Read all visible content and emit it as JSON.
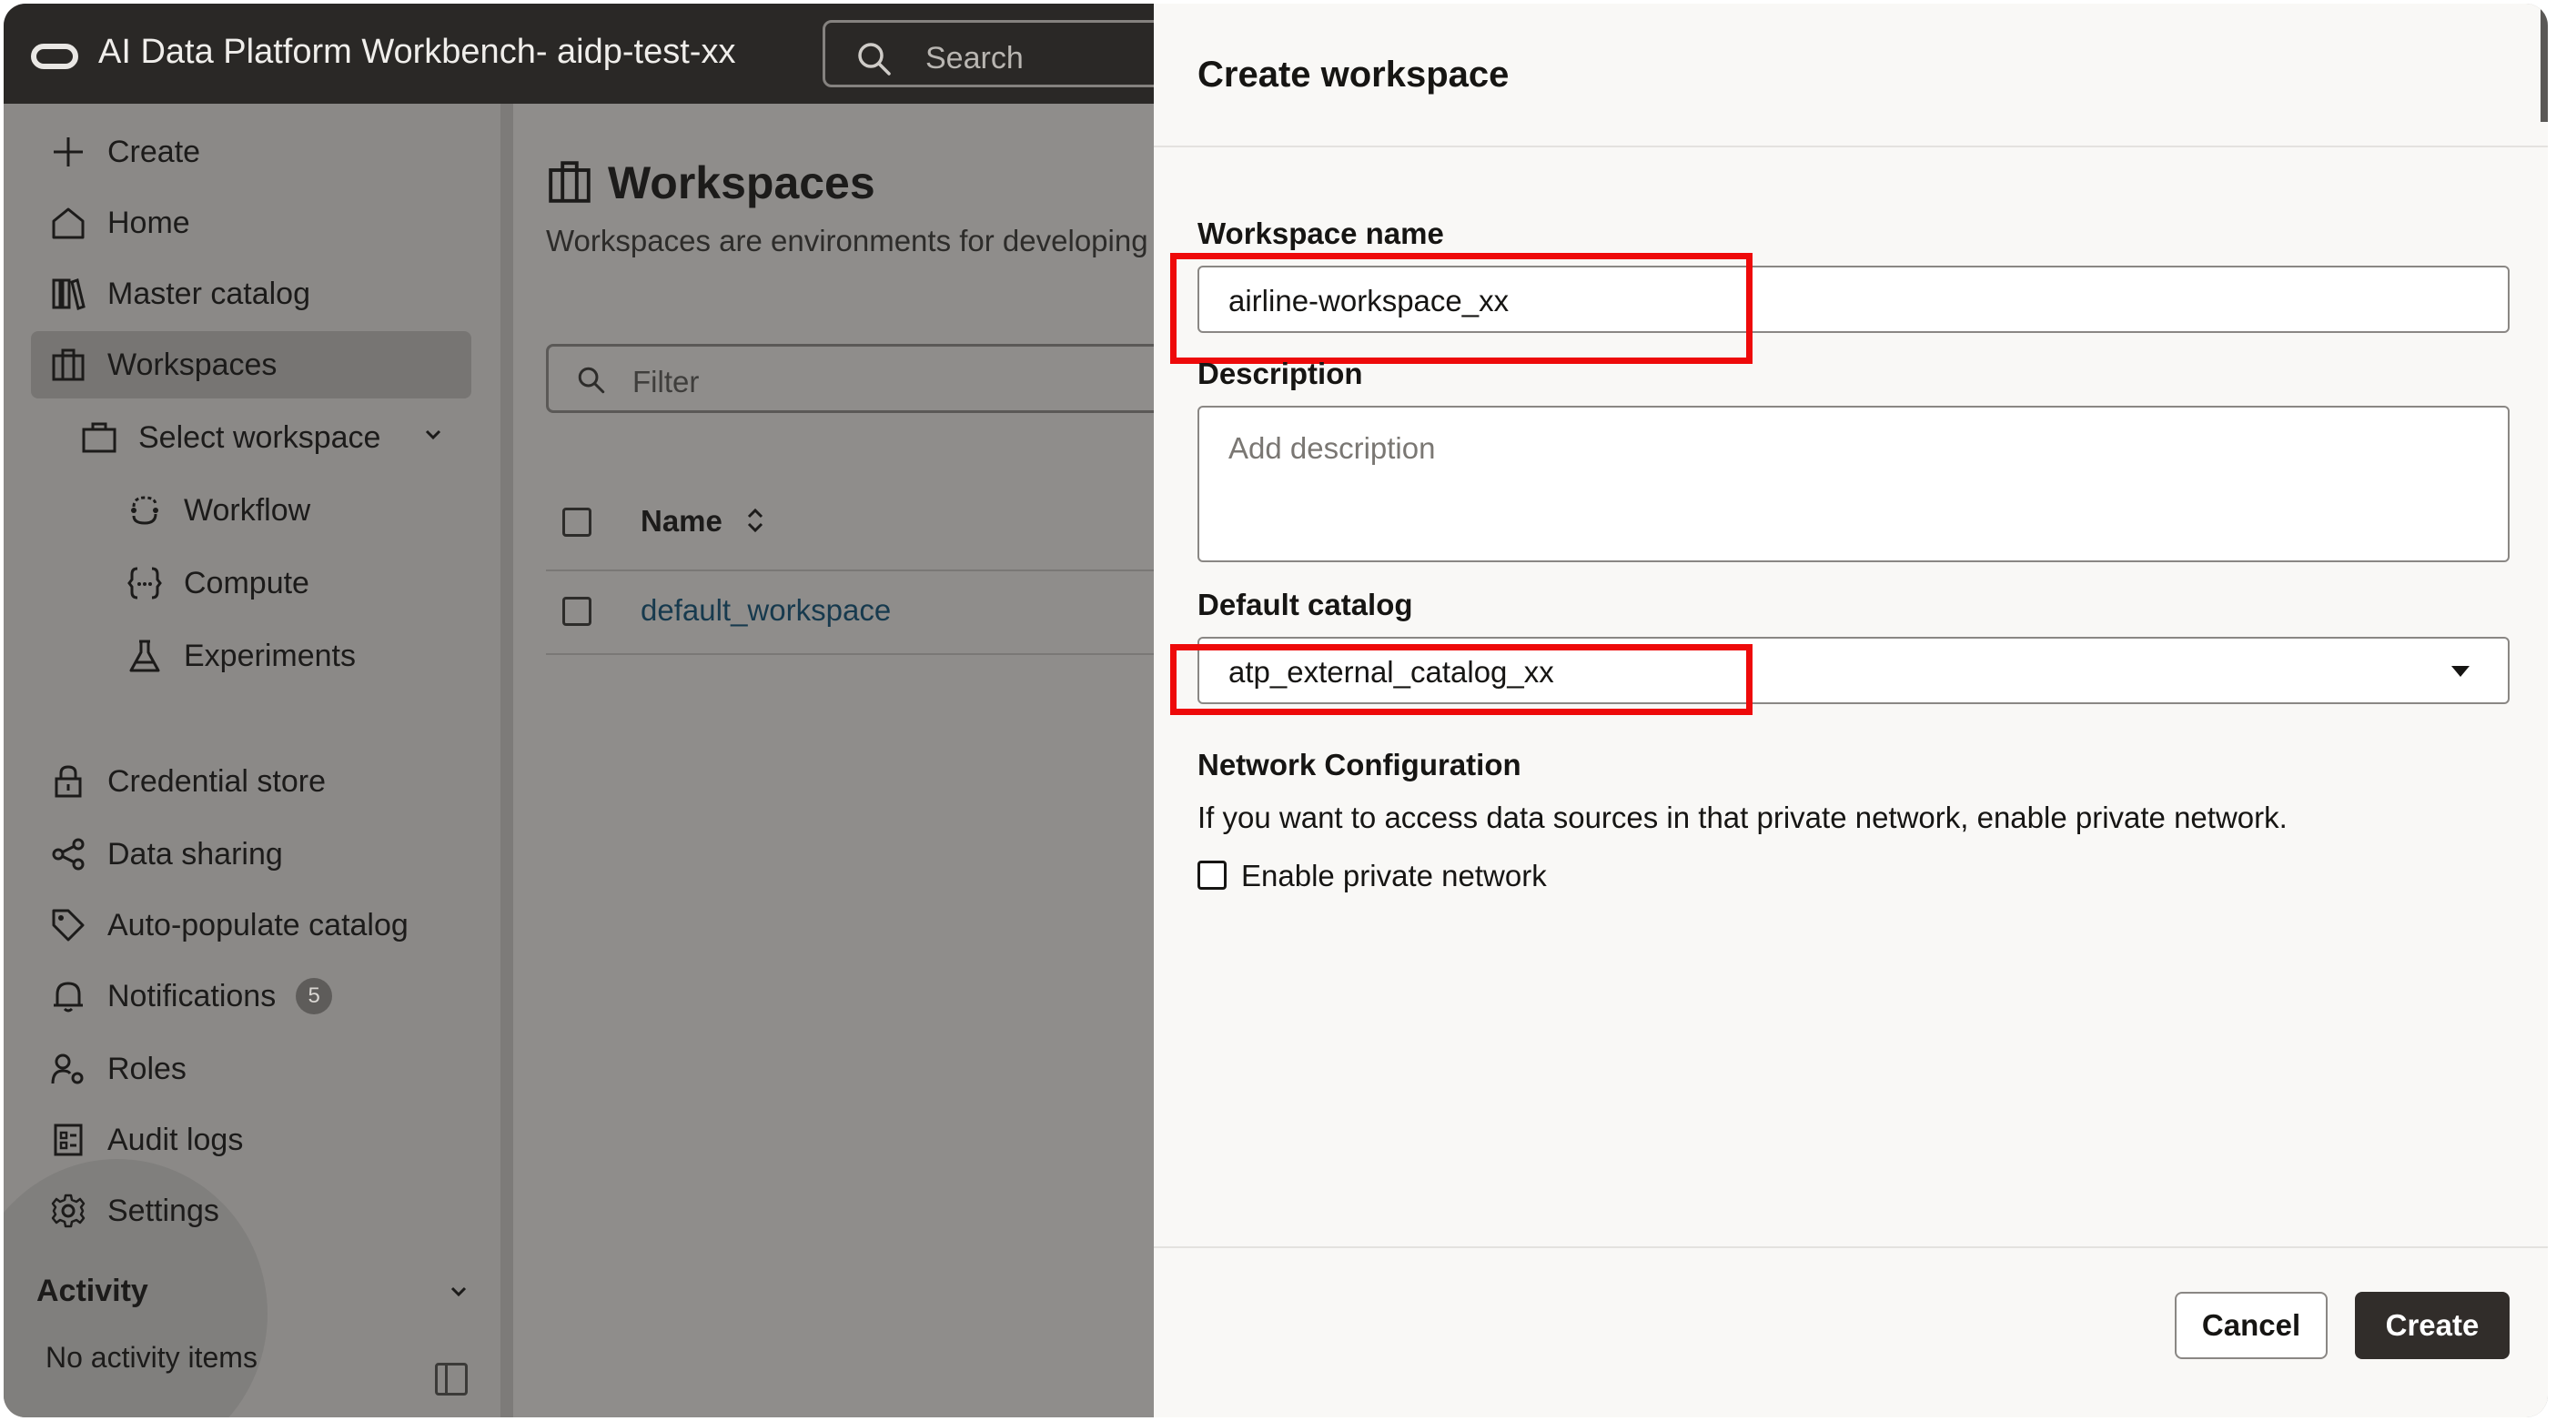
{
  "topbar": {
    "app_title": "AI Data Platform Workbench- aidp-test-xx",
    "search_placeholder": "Search"
  },
  "sidebar": {
    "items": [
      {
        "label": "Create",
        "icon": "plus-icon"
      },
      {
        "label": "Home",
        "icon": "home-icon"
      },
      {
        "label": "Master catalog",
        "icon": "catalog-icon"
      },
      {
        "label": "Workspaces",
        "icon": "workspaces-icon",
        "active": true
      },
      {
        "label": "Select workspace",
        "icon": "briefcase-icon"
      },
      {
        "label": "Workflow",
        "icon": "workflow-icon"
      },
      {
        "label": "Compute",
        "icon": "compute-icon"
      },
      {
        "label": "Experiments",
        "icon": "flask-icon"
      },
      {
        "label": "Credential store",
        "icon": "lock-icon"
      },
      {
        "label": "Data sharing",
        "icon": "share-icon"
      },
      {
        "label": "Auto-populate catalog",
        "icon": "tag-icon"
      },
      {
        "label": "Notifications",
        "icon": "bell-icon",
        "badge": "5"
      },
      {
        "label": "Roles",
        "icon": "roles-icon"
      },
      {
        "label": "Audit logs",
        "icon": "audit-log-icon"
      },
      {
        "label": "Settings",
        "icon": "gear-icon"
      }
    ],
    "activity": {
      "title": "Activity",
      "empty_text": "No activity items"
    }
  },
  "main": {
    "title": "Workspaces",
    "description": "Workspaces are environments for developing",
    "filter_placeholder": "Filter",
    "table": {
      "columns": [
        "Name"
      ],
      "rows": [
        {
          "name": "default_workspace"
        }
      ]
    }
  },
  "drawer": {
    "title": "Create workspace",
    "workspace_name_label": "Workspace name",
    "workspace_name_value": "airline-workspace_xx",
    "description_label": "Description",
    "description_placeholder": "Add description",
    "default_catalog_label": "Default catalog",
    "default_catalog_value": "atp_external_catalog_xx",
    "network_title": "Network Configuration",
    "network_description": "If you want to access data sources in that private network, enable private network.",
    "enable_private_network_label": "Enable private network",
    "cancel_label": "Cancel",
    "create_label": "Create"
  },
  "colors": {
    "highlight": "#ee0a0a",
    "primary_button": "#312d2a",
    "topbar": "#2a2826",
    "link": "#173a4e"
  }
}
